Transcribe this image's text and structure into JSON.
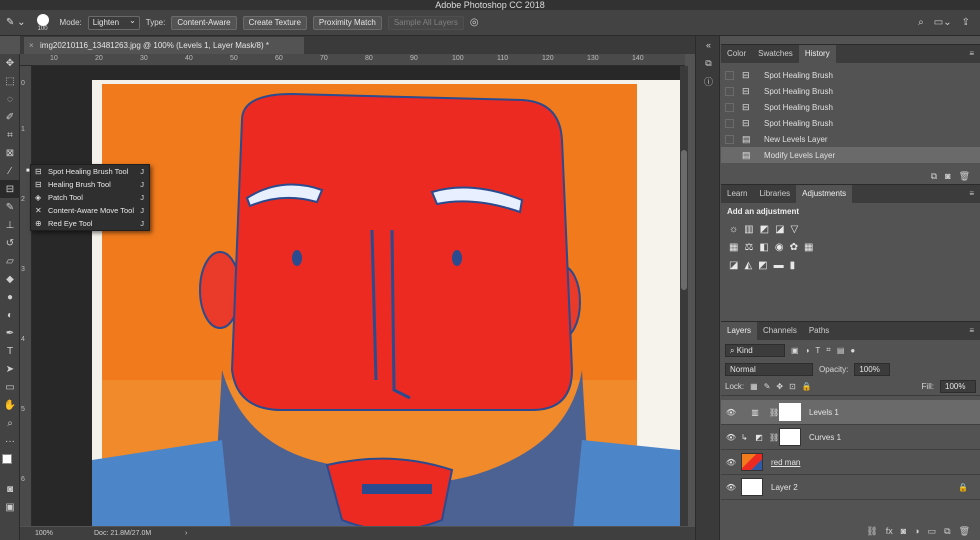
{
  "app": {
    "title": "Adobe Photoshop CC 2018"
  },
  "options": {
    "brush_size": "100",
    "mode_label": "Mode:",
    "mode_value": "Lighten",
    "type_label": "Type:",
    "type_content_aware": "Content-Aware",
    "type_create_texture": "Create Texture",
    "type_proximity": "Proximity Match",
    "sample_all": "Sample All Layers"
  },
  "document": {
    "tab_title": "img20210116_13481263.jpg @ 100% (Levels 1, Layer Mask/8) *",
    "zoom": "100%",
    "doc_info": "Doc: 21.8M/27.0M"
  },
  "ruler": {
    "h_ticks": [
      "10",
      "20",
      "30",
      "40",
      "50",
      "60",
      "70",
      "80",
      "90",
      "100",
      "110",
      "120",
      "130",
      "140"
    ],
    "v_ticks": [
      "0",
      "1",
      "2",
      "3",
      "4",
      "5",
      "6"
    ]
  },
  "flyout": {
    "items": [
      {
        "label": "Spot Healing Brush Tool",
        "key": "J",
        "icon": "spot-healing-icon"
      },
      {
        "label": "Healing Brush Tool",
        "key": "J",
        "icon": "healing-brush-icon"
      },
      {
        "label": "Patch Tool",
        "key": "J",
        "icon": "patch-icon"
      },
      {
        "label": "Content-Aware Move Tool",
        "key": "J",
        "icon": "move-icon"
      },
      {
        "label": "Red Eye Tool",
        "key": "J",
        "icon": "red-eye-icon"
      }
    ]
  },
  "history_panel": {
    "tabs": [
      "Color",
      "Swatches",
      "History"
    ],
    "items": [
      {
        "label": "Spot Healing Brush",
        "icon": "bandage-icon"
      },
      {
        "label": "Spot Healing Brush",
        "icon": "bandage-icon"
      },
      {
        "label": "Spot Healing Brush",
        "icon": "bandage-icon"
      },
      {
        "label": "Spot Healing Brush",
        "icon": "bandage-icon"
      },
      {
        "label": "New Levels Layer",
        "icon": "document-icon"
      },
      {
        "label": "Modify Levels Layer",
        "icon": "document-icon"
      }
    ]
  },
  "adjust_panel": {
    "tabs": [
      "Learn",
      "Libraries",
      "Adjustments"
    ],
    "title": "Add an adjustment"
  },
  "layers_panel": {
    "tabs": [
      "Layers",
      "Channels",
      "Paths"
    ],
    "kind": "Kind",
    "blend": "Normal",
    "opacity_label": "Opacity:",
    "opacity": "100%",
    "lock_label": "Lock:",
    "fill_label": "Fill:",
    "fill": "100%",
    "layers": [
      {
        "name": "Levels 1"
      },
      {
        "name": "Curves 1"
      },
      {
        "name": "red man"
      },
      {
        "name": "Layer 2"
      }
    ]
  },
  "colors": {
    "accent": "#535353",
    "panel_dark": "#3c3c3c"
  }
}
